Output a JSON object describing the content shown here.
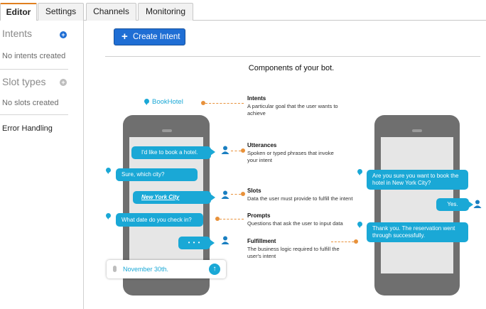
{
  "tabs": [
    {
      "label": "Editor",
      "active": true
    },
    {
      "label": "Settings",
      "active": false
    },
    {
      "label": "Channels",
      "active": false
    },
    {
      "label": "Monitoring",
      "active": false
    }
  ],
  "sidebar": {
    "intents_heading": "Intents",
    "intents_empty": "No intents created",
    "slot_types_heading": "Slot types",
    "slots_empty": "No slots created",
    "error_handling": "Error Handling"
  },
  "main": {
    "create_intent_label": "Create Intent",
    "components_title": "Components of your bot."
  },
  "phone_left": {
    "intent_name": "BookHotel",
    "user_msg_1": "I'd like to book a hotel.",
    "bot_msg_1": "Sure, which city?",
    "user_msg_2": "New York City",
    "bot_msg_2": "What date do you check in?",
    "typing": "• • •",
    "input_value": "November 30th."
  },
  "phone_right": {
    "bot_msg_1": "Are you sure you want to book the hotel in New York City?",
    "user_msg_1": "Yes.",
    "bot_msg_2": "Thank you. The reservation went through successfully."
  },
  "components": [
    {
      "title": "Intents",
      "desc": "A particular goal that the user wants to achieve"
    },
    {
      "title": "Utterances",
      "desc": "Spoken or typed phrases that invoke your intent"
    },
    {
      "title": "Slots",
      "desc": "Data the user must provide to fulfill the intent"
    },
    {
      "title": "Prompts",
      "desc": "Questions that ask the user to input data"
    },
    {
      "title": "Fulfillment",
      "desc": "The business logic required to fulfill the user's intent"
    }
  ],
  "colors": {
    "accent": "#1aa8d6",
    "button_blue": "#1f6ed4",
    "tab_active_border": "#e07f1f",
    "connector": "#e8913a",
    "phone_body": "#6f6f6f"
  },
  "icons": {
    "add_intent": "plus-circle-icon",
    "add_slot_type": "plus-circle-icon",
    "create_plus": "plus-icon",
    "bot": "chat-pin-icon",
    "user": "user-icon",
    "mic": "microphone-icon",
    "send": "arrow-up-circle-icon"
  }
}
